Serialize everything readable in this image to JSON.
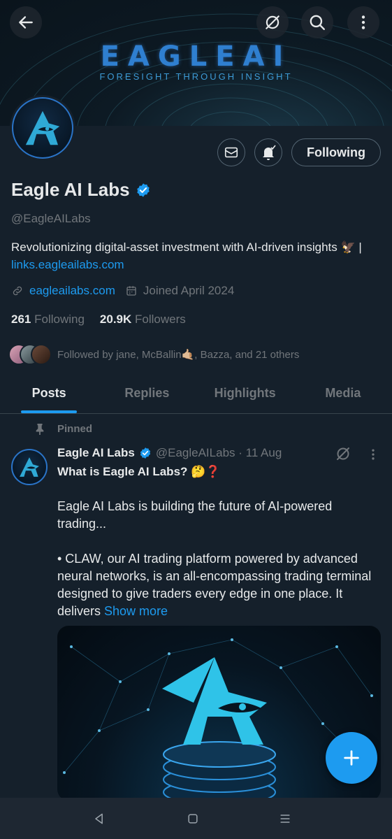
{
  "banner": {
    "brand": "EAGLEAI",
    "tagline": "FORESIGHT THROUGH INSIGHT"
  },
  "topbar": {
    "back_icon": "arrow-left-icon",
    "grok_icon": "slash-circle-icon",
    "search_icon": "search-icon",
    "more_icon": "more-vertical-icon"
  },
  "profile": {
    "name": "Eagle AI Labs",
    "handle": "@EagleAILabs",
    "bio_text": "Revolutionizing digital-asset investment with AI-driven insights 🦅 | ",
    "bio_link": "links.eagleailabs.com",
    "website": "eagleailabs.com",
    "joined": "Joined April 2024",
    "following_count": "261",
    "following_label": "Following",
    "followers_count": "20.9K",
    "followers_label": "Followers",
    "followed_by": "Followed by jane, McBallin🤙🏼, Bazza, and 21 others",
    "following_button": "Following"
  },
  "tabs": [
    {
      "label": "Posts",
      "active": true
    },
    {
      "label": "Replies",
      "active": false
    },
    {
      "label": "Highlights",
      "active": false
    },
    {
      "label": "Media",
      "active": false
    }
  ],
  "post": {
    "pinned_label": "Pinned",
    "author": "Eagle AI Labs",
    "handle_date": "@EagleAILabs · 11 Aug",
    "title": "What is Eagle AI Labs? 🤔❓",
    "para1": "Eagle AI Labs is building the future of AI-powered trading...",
    "para2": "• CLAW, our AI trading platform powered by advanced neural networks, is an all-encompassing trading terminal designed to give traders every edge in one place. It delivers ",
    "show_more": "Show more"
  },
  "colors": {
    "background": "#15202b",
    "accent": "#1d9bf0",
    "muted": "#71767b",
    "border": "#536471"
  }
}
